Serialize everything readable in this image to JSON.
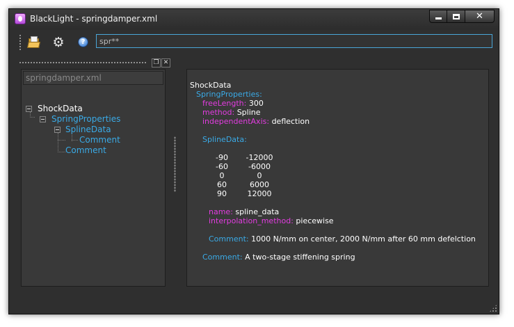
{
  "window": {
    "title": "BlackLight - springdamper.xml",
    "minimize": "",
    "maximize": "",
    "close": "✕"
  },
  "toolbar": {
    "search_value": "spr**"
  },
  "tree": {
    "header": "springdamper.xml",
    "items": [
      {
        "label": "ShockData",
        "level": 0
      },
      {
        "label": "SpringProperties",
        "level": 1
      },
      {
        "label": "SplineData",
        "level": 2
      },
      {
        "label": "Comment",
        "level": 3
      },
      {
        "label": "Comment",
        "level": 2
      }
    ]
  },
  "detail": {
    "root": "ShockData",
    "spring_properties": "SpringProperties:",
    "free_length_key": "freeLength:",
    "free_length_val": "300",
    "method_key": "method:",
    "method_val": "Spline",
    "indep_axis_key": "independentAxis:",
    "indep_axis_val": "deflection",
    "spline_data": "SplineData:",
    "spline_rows": [
      {
        "x": "-90",
        "y": "-12000"
      },
      {
        "x": "-60",
        "y": "-6000"
      },
      {
        "x": "0",
        "y": "0"
      },
      {
        "x": "60",
        "y": "6000"
      },
      {
        "x": "90",
        "y": "12000"
      }
    ],
    "name_key": "name:",
    "name_val": "spline_data",
    "interp_key": "interpolation_method:",
    "interp_val": "piecewise",
    "comment1_key": "Comment:",
    "comment1_val": "1000 N/mm on center, 2000 N/mm after 60 mm defelction",
    "comment2_key": "Comment:",
    "comment2_val": "A two-stage stiffening spring"
  },
  "colors": {
    "background": "#2f2f2f",
    "panel": "#393939",
    "accent_blue": "#3aaae6",
    "key_pink": "#e23ce0",
    "search_border": "#4aa6d8"
  }
}
